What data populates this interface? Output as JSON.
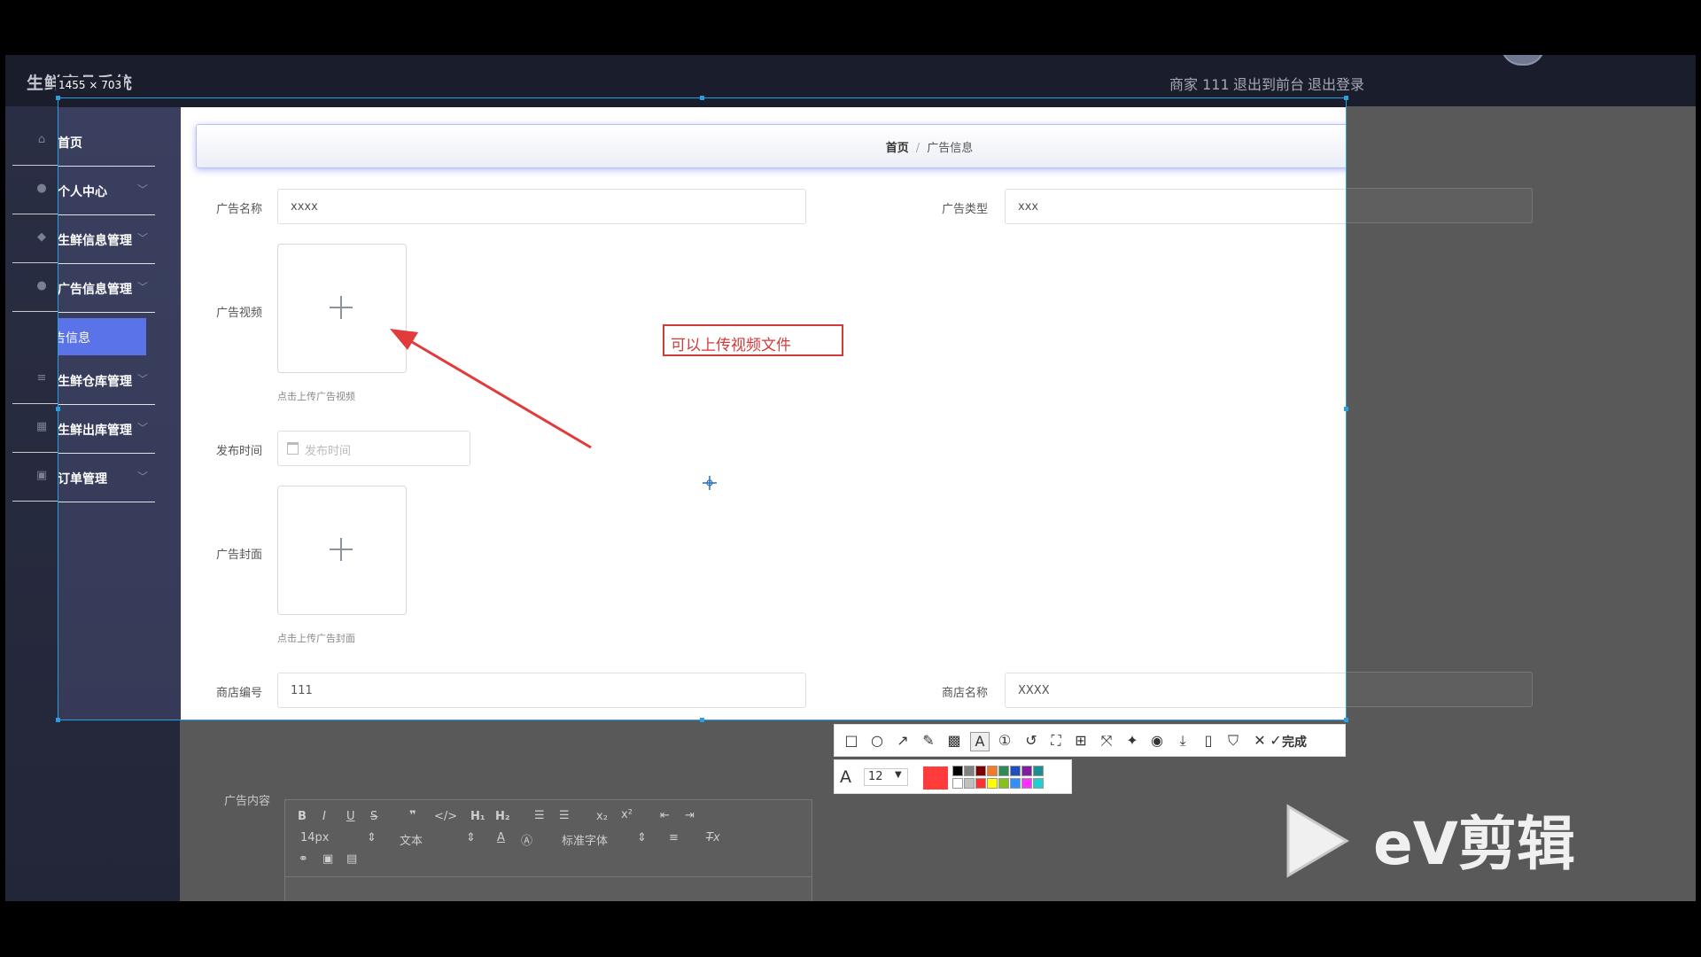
{
  "app": {
    "logo": "生鲜商品系统",
    "header": {
      "merchant": "商家 111",
      "back_front": "退出到前台",
      "logout": "退出登录"
    }
  },
  "sidebar": {
    "items": [
      {
        "label": "首页",
        "icon": "home-icon"
      },
      {
        "label": "个人中心",
        "icon": "user-icon"
      },
      {
        "label": "生鲜信息管理",
        "icon": "leaf-icon"
      },
      {
        "label": "广告信息管理",
        "icon": "user-icon"
      },
      {
        "label": "生鲜仓库管理",
        "icon": "list-icon"
      },
      {
        "label": "生鲜出库管理",
        "icon": "grid-icon"
      },
      {
        "label": "订单管理",
        "icon": "order-icon"
      }
    ],
    "active_sub": "广告信息"
  },
  "breadcrumb": {
    "home": "首页",
    "current": "广告信息"
  },
  "form": {
    "ad_name_label": "广告名称",
    "ad_name_value": "xxxx",
    "ad_type_label": "广告类型",
    "ad_type_value": "xxx",
    "ad_video_label": "广告视频",
    "ad_video_hint": "点击上传广告视频",
    "publish_time_label": "发布时间",
    "publish_time_placeholder": "发布时间",
    "ad_cover_label": "广告封面",
    "ad_cover_hint": "点击上传广告封面",
    "shop_no_label": "商店编号",
    "shop_no_value": "111",
    "shop_name_label": "商店名称",
    "shop_name_value": "XXXX",
    "ad_content_label": "广告内容"
  },
  "editor": {
    "font_size": "14px",
    "text_style": "文本",
    "font_family": "标准字体"
  },
  "screenshot_tool": {
    "size_label": "1455 × 703",
    "annotation_text": "可以上传视频文件",
    "done_label": "完成",
    "font_size_value": "12",
    "current_color": "#ff3b3b",
    "palette": [
      "#000000",
      "#808080",
      "#800000",
      "#f47a24",
      "#2e8b57",
      "#1f4fbf",
      "#7f1f9f",
      "#1a8f8f",
      "#ffffff",
      "#c0c0c0",
      "#ff3030",
      "#ffff00",
      "#88c020",
      "#3090ff",
      "#ff30ff",
      "#20d0d0"
    ]
  },
  "watermark": {
    "text": "eV剪辑"
  }
}
